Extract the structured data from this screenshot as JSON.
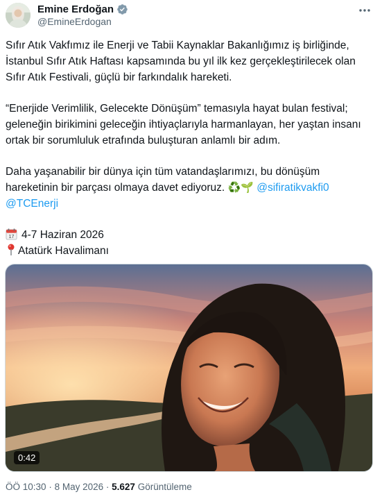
{
  "author": {
    "display_name": "Emine Erdoğan",
    "handle": "@EmineErdogan",
    "verified_icon": "verified-badge-icon",
    "more_icon": "more-options-icon"
  },
  "tweet": {
    "para1": "Sıfır Atık Vakfımız ile Enerji ve Tabii Kaynaklar Bakanlığımız iş birliğinde, İstanbul Sıfır Atık Haftası kapsamında bu yıl ilk kez gerçekleştirilecek olan Sıfır Atık Festivali, güçlü bir farkındalık hareketi.",
    "para2": "“Enerjide Verimlilik, Gelecekte Dönüşüm” temasıyla hayat bulan festival; geleneğin birikimini geleceğin ihtiyaçlarıyla harmanlayan, her yaştan insanı ortak bir sorumluluk etrafında buluşturan anlamlı bir adım.",
    "para3": "Daha yaşanabilir bir dünya için tüm vatandaşlarımızı, bu dönüşüm hareketinin bir parçası olmaya davet ediyoruz.",
    "emoji_recycle": "♻️",
    "emoji_seedling": "🌱",
    "mention1": "@sifiratikvakfi0",
    "mention2": "@TCEnerji",
    "calendar_icon": "calendar-icon",
    "date_text": "4-7 Haziran 2026",
    "pin_icon": "location-pin-icon",
    "location_text": "Atatürk Havalimanı"
  },
  "media": {
    "type": "video",
    "duration": "0:42"
  },
  "meta": {
    "time": "ÖÖ 10:30",
    "separator": "·",
    "date": "8 May 2026",
    "views_count": "5.627",
    "views_label": "Görüntüleme"
  }
}
